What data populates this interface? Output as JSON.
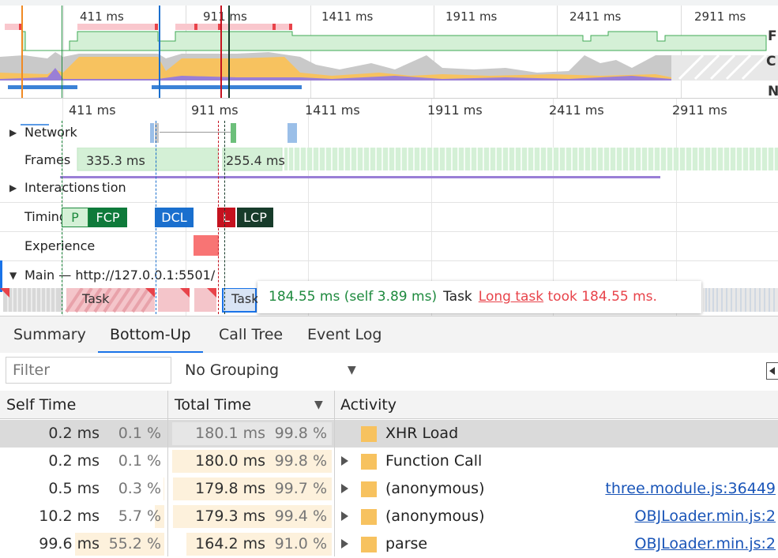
{
  "overview": {
    "tick_labels": [
      "411 ms",
      "911 ms",
      "1411 ms",
      "1911 ms",
      "2411 ms",
      "2911 ms"
    ],
    "track_labels": [
      "F",
      "C",
      "N"
    ]
  },
  "timeline": {
    "tick_labels": [
      "411 ms",
      "911 ms",
      "1411 ms",
      "1911 ms",
      "2411 ms",
      "2911 ms"
    ],
    "tracks": {
      "network": "Network",
      "frames": "Frames",
      "interactions": "Interactions",
      "timings": "Timings",
      "experience": "Experience",
      "main": "Main — http://127.0.0.1:5501/"
    },
    "frame_values": [
      "335.3 ms",
      "255.4 ms"
    ],
    "interactions_overlap": "tion",
    "timing_markers": {
      "fp": "P",
      "fcp": "FCP",
      "dcl": "DCL",
      "l": "L",
      "lcp": "LCP"
    },
    "main_tasks": [
      "Task",
      "Task"
    ]
  },
  "tooltip": {
    "duration": "184.55 ms (self 3.89 ms)",
    "name": "Task",
    "link": "Long task",
    "suffix": "took 184.55 ms."
  },
  "tabs": [
    "Summary",
    "Bottom-Up",
    "Call Tree",
    "Event Log"
  ],
  "active_tab": "Bottom-Up",
  "toolbar": {
    "filter_placeholder": "Filter",
    "grouping": "No Grouping"
  },
  "table": {
    "headers": {
      "self": "Self Time",
      "total": "Total Time",
      "activity": "Activity"
    },
    "rows": [
      {
        "self": "0.2 ms",
        "self_pct": "0.1 %",
        "total": "180.1 ms",
        "total_pct": "99.8 %",
        "activity": "XHR Load",
        "link": "",
        "expandable": false,
        "selected": true
      },
      {
        "self": "0.2 ms",
        "self_pct": "0.1 %",
        "total": "180.0 ms",
        "total_pct": "99.8 %",
        "activity": "Function Call",
        "link": "",
        "expandable": true,
        "selected": false
      },
      {
        "self": "0.5 ms",
        "self_pct": "0.3 %",
        "total": "179.8 ms",
        "total_pct": "99.7 %",
        "activity": "(anonymous)",
        "link": "three.module.js:36449",
        "expandable": true,
        "selected": false
      },
      {
        "self": "10.2 ms",
        "self_pct": "5.7 %",
        "total": "179.3 ms",
        "total_pct": "99.4 %",
        "activity": "(anonymous)",
        "link": "OBJLoader.min.js:2",
        "expandable": true,
        "selected": false
      },
      {
        "self": "99.6 ms",
        "self_pct": "55.2 %",
        "total": "164.2 ms",
        "total_pct": "91.0 %",
        "activity": "parse",
        "link": "OBJLoader.min.js:2",
        "expandable": true,
        "selected": false
      }
    ]
  },
  "colors": {
    "scripting": "#f7c25f",
    "rendering": "#9a7fd6",
    "idle_frame": "#d4f0d6",
    "fcp": "#0e7a3a",
    "dcl": "#1a6fce",
    "load": "#c5121f",
    "lcp": "#173b2a",
    "experience": "#f87474",
    "long_task": "#e8434a",
    "link": "#1a55b8",
    "tab_active": "#1a73e8"
  }
}
